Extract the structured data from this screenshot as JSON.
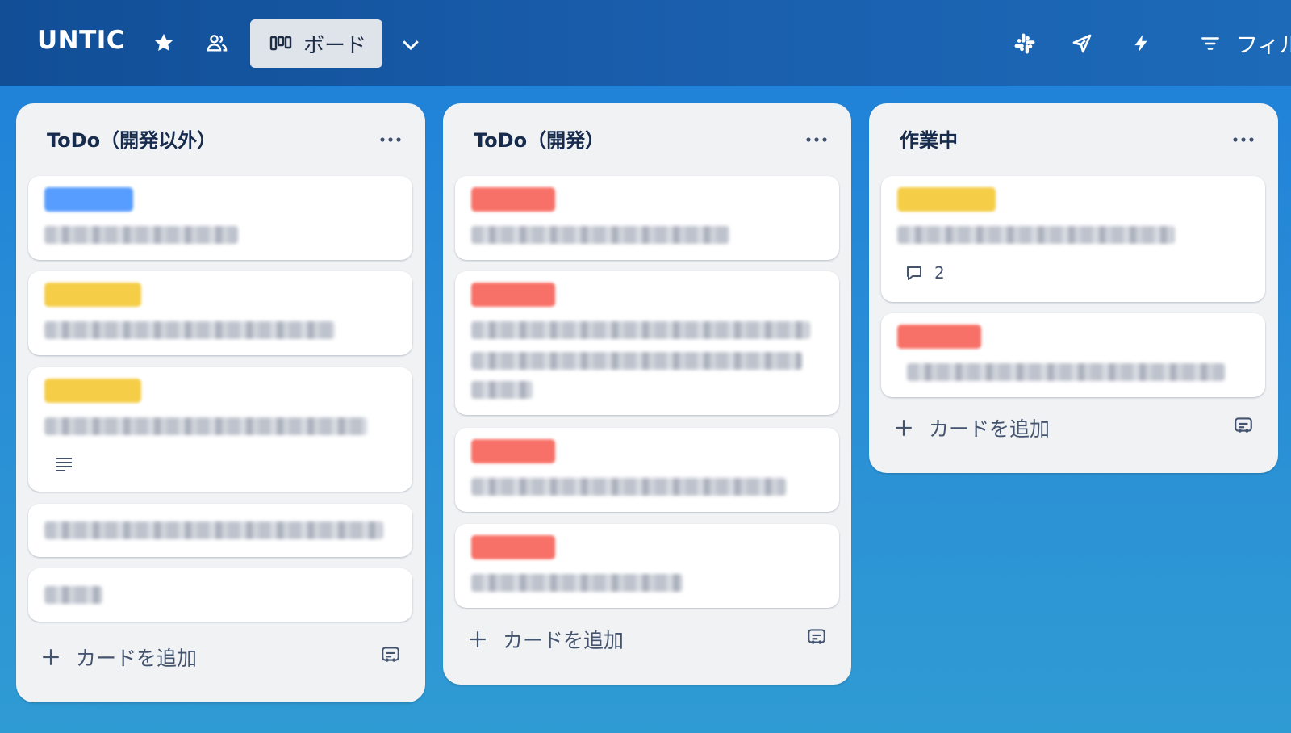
{
  "header": {
    "board_name": "UNTIC",
    "view_label": "ボード",
    "filter_label": "フィル",
    "icons": [
      "star-icon",
      "workspace-visibility-icon",
      "board-view-icon",
      "chevron-down-icon",
      "slack-icon",
      "rocket-icon",
      "automation-icon",
      "filter-icon"
    ]
  },
  "colors": {
    "label_blue": "#579dff",
    "label_yellow": "#f5cd47",
    "label_red": "#f87168",
    "list_bg": "#f1f2f4",
    "header_bg": "#1a5fae",
    "text_dark": "#172b4d"
  },
  "lists": [
    {
      "title": "ToDo（開発以外）",
      "add_card_label": "カードを追加",
      "cards": [
        {
          "label_color": "blue",
          "has_description": false
        },
        {
          "label_color": "yellow",
          "has_description": false
        },
        {
          "label_color": "yellow",
          "has_description": true
        },
        {
          "label_color": "none",
          "has_description": false
        },
        {
          "label_color": "none",
          "has_description": false
        }
      ]
    },
    {
      "title": "ToDo（開発）",
      "add_card_label": "カードを追加",
      "cards": [
        {
          "label_color": "red"
        },
        {
          "label_color": "red"
        },
        {
          "label_color": "red"
        },
        {
          "label_color": "red"
        }
      ]
    },
    {
      "title": "作業中",
      "add_card_label": "カードを追加",
      "cards": [
        {
          "label_color": "yellow",
          "comment_count": "2"
        },
        {
          "label_color": "red"
        }
      ]
    }
  ]
}
